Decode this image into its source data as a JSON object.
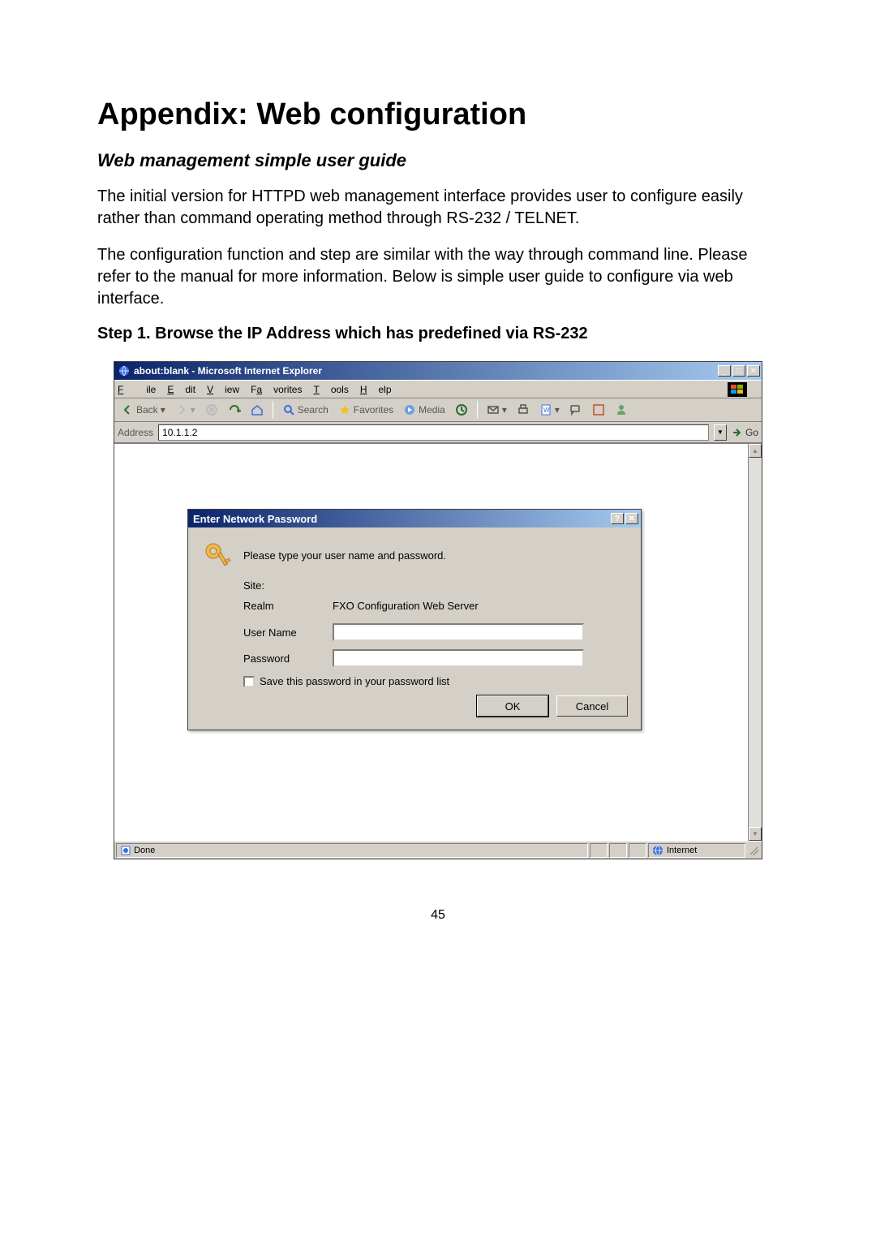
{
  "page": {
    "title": "Appendix: Web configuration",
    "subheader": "Web management simple user guide",
    "para1": "The initial version for HTTPD web management interface provides user to configure easily rather than command operating method through RS-232 / TELNET.",
    "para2": "The configuration function and step are similar with the way through command line. Please refer to the manual for more information. Below is simple user guide to configure via web interface.",
    "step1": "Step 1. Browse the IP Address which has predefined via RS-232",
    "pageNumber": "45"
  },
  "browser": {
    "title": "about:blank - Microsoft Internet Explorer",
    "menu": {
      "file": "File",
      "edit": "Edit",
      "view": "View",
      "favorites": "Favorites",
      "tools": "Tools",
      "help": "Help"
    },
    "tb": {
      "back": "Back",
      "search": "Search",
      "favorites": "Favorites",
      "media": "Media"
    },
    "addressLabel": "Address",
    "addressValue": "10.1.1.2",
    "go": "Go",
    "status": "Done",
    "zone": "Internet"
  },
  "dialog": {
    "title": "Enter Network Password",
    "prompt": "Please type your user name and password.",
    "siteLabel": "Site:",
    "siteValue": "",
    "realmLabel": "Realm",
    "realmValue": "FXO Configuration Web Server",
    "userLabel": "User Name",
    "passLabel": "Password",
    "saveLabel": "Save this password in your password list",
    "ok": "OK",
    "cancel": "Cancel"
  }
}
